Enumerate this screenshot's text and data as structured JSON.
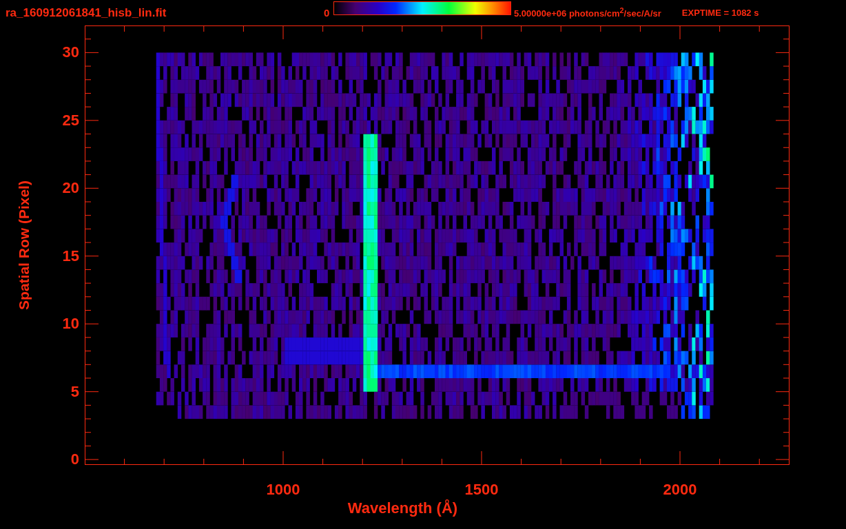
{
  "header": {
    "file_name": "ra_160912061841_hisb_lin.fit",
    "colorbar_min": "0",
    "colorbar_max": "5.00000e+06 photons/cm$^{2}$/sec/A/sr",
    "exptime": "EXPTIME = 1082 s"
  },
  "plot": {
    "y_axis": {
      "label": "Spatial Row (Pixel)",
      "ticks": [
        "30",
        "25",
        "20",
        "15",
        "10",
        "5",
        "0"
      ]
    },
    "x_axis": {
      "label": "Wavelength (Å)",
      "ticks": [
        "1000",
        "1500",
        "2000"
      ]
    }
  }
}
